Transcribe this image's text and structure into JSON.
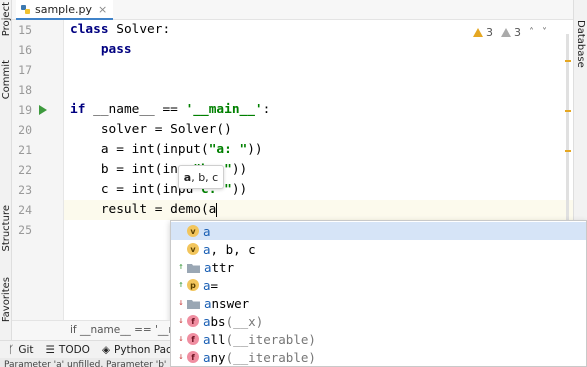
{
  "tab": {
    "label": "sample.py"
  },
  "left_tools": [
    "Project",
    "Commit",
    "Structure",
    "Favorites"
  ],
  "right_tools": [
    "Database"
  ],
  "inspections": {
    "warnings": "3",
    "weak_warnings": "3"
  },
  "editor": {
    "lines": [
      {
        "number": "15",
        "segments": [
          [
            "kw",
            "class"
          ],
          [
            "",
            " Solver:"
          ]
        ]
      },
      {
        "number": "16",
        "segments": [
          [
            "kw",
            "    pass"
          ]
        ]
      },
      {
        "number": "17",
        "segments": []
      },
      {
        "number": "18",
        "segments": []
      },
      {
        "number": "19",
        "segments": [
          [
            "kw",
            "if"
          ],
          [
            "",
            " __name__ == "
          ],
          [
            "str",
            "'__main__'"
          ],
          [
            "",
            ":"
          ]
        ]
      },
      {
        "number": "20",
        "segments": [
          [
            "",
            "    solver = Solver()"
          ]
        ]
      },
      {
        "number": "21",
        "segments": [
          [
            "",
            "    a = int(input("
          ],
          [
            "str",
            "\"a: \""
          ],
          [
            "",
            "))"
          ]
        ]
      },
      {
        "number": "22",
        "segments": [
          [
            "",
            "    b = int(inpu"
          ],
          [
            "str",
            "\"b: \""
          ],
          [
            "",
            "))"
          ]
        ]
      },
      {
        "number": "23",
        "segments": [
          [
            "",
            "    c = int(inpu"
          ],
          [
            "str",
            "\"c: \""
          ],
          [
            "",
            "))"
          ]
        ]
      },
      {
        "number": "24",
        "segments": [
          [
            "",
            "    result = demo(a"
          ]
        ]
      },
      {
        "number": "25",
        "segments": []
      }
    ]
  },
  "param_hint": {
    "current": "a",
    "rest": ", b, c"
  },
  "completion": {
    "items": [
      {
        "badge": "v",
        "arrow": "",
        "match": "a",
        "rest": "",
        "sig": ""
      },
      {
        "badge": "v",
        "arrow": "",
        "match": "a",
        "rest": ", b, c",
        "sig": ""
      },
      {
        "badge": "folder",
        "arrow": "up",
        "match": "a",
        "rest": "ttr",
        "sig": ""
      },
      {
        "badge": "p",
        "arrow": "up",
        "match": "a",
        "rest": "=",
        "sig": ""
      },
      {
        "badge": "folder",
        "arrow": "down",
        "match": "a",
        "rest": "nswer",
        "sig": ""
      },
      {
        "badge": "f",
        "arrow": "down",
        "match": "a",
        "rest": "bs",
        "sig": "(__x)"
      },
      {
        "badge": "f",
        "arrow": "down",
        "match": "a",
        "rest": "ll",
        "sig": "(__iterable)"
      },
      {
        "badge": "f",
        "arrow": "down",
        "match": "a",
        "rest": "ny",
        "sig": "(__iterable)"
      }
    ]
  },
  "breadcrumb": "if __name__ == '__main__'",
  "bottom_tools": [
    "Git",
    "TODO",
    "Python Packages"
  ],
  "status": "Parameter 'a' unfilled, Parameter 'b' unfilled",
  "colors": {
    "keyword": "#000080",
    "string": "#008000",
    "selection": "#d6e4f7",
    "run": "#3d9a3d"
  }
}
